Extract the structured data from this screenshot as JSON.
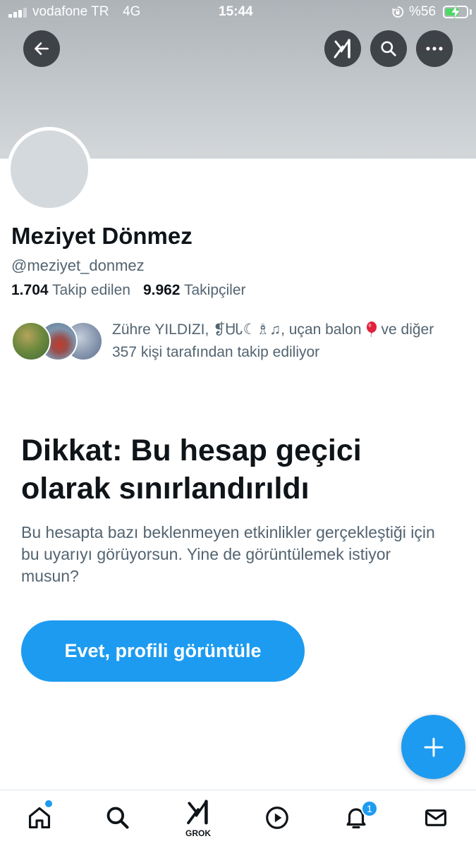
{
  "status_bar": {
    "carrier": "vodafone TR",
    "network": "4G",
    "time": "15:44",
    "battery_percent": "%56",
    "battery_level": 0.56,
    "battery_color": "#4cd964"
  },
  "header": {
    "back_icon": "arrow-left-icon",
    "grok_icon": "grok-icon",
    "search_icon": "search-icon",
    "more_icon": "more-horizontal-icon"
  },
  "profile": {
    "display_name": "Meziyet Dönmez",
    "handle": "@meziyet_donmez",
    "following_count": "1.704",
    "following_label": "Takip edilen",
    "followers_count": "9.962",
    "followers_label": "Takipçiler"
  },
  "followed_by": {
    "line1": "Zühre YILDIZI, ❡ᏌᏓ☾♗♫, uçan balon",
    "line1_suffix": "ve diğer",
    "line2": "357 kişi tarafından takip ediliyor"
  },
  "warning": {
    "title": "Dikkat: Bu hesap geçici olarak sınırlandırıldı",
    "body": "Bu hesapta bazı beklenmeyen etkinlikler gerçekleştiği için bu uyarıyı görüyorsun. Yine de görüntülemek istiyor musun?",
    "button_label": "Evet, profili görüntüle"
  },
  "fab": {
    "icon": "plus-icon"
  },
  "tabbar": {
    "grok_label": "GROK",
    "notification_badge": "1",
    "accent": "#1d9bf0"
  }
}
